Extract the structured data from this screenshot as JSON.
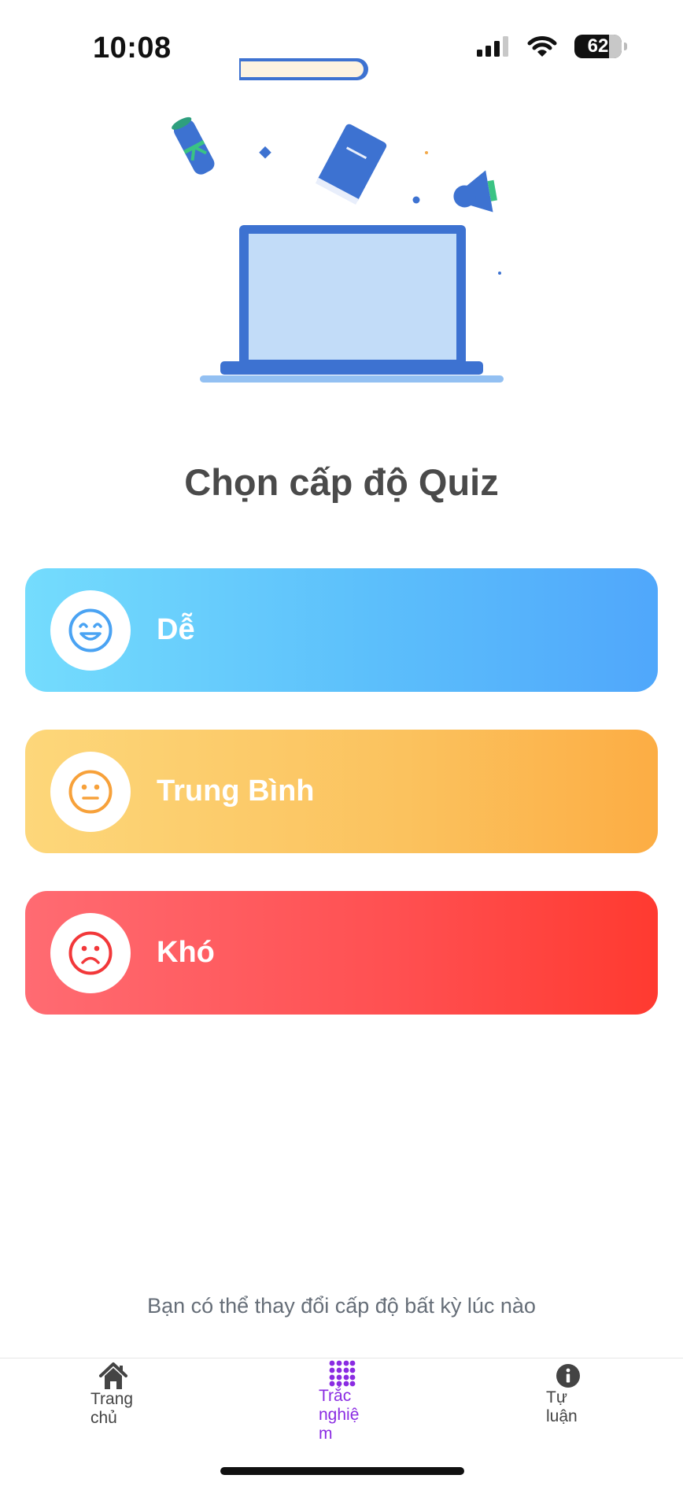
{
  "status_bar": {
    "time": "10:08",
    "battery": "62"
  },
  "title": "Chọn cấp độ Quiz",
  "levels": [
    {
      "label": "Dễ",
      "icon": "smile-face-icon",
      "color": "#5cbffb"
    },
    {
      "label": "Trung Bình",
      "icon": "neutral-face-icon",
      "color": "#fbc25e"
    },
    {
      "label": "Khó",
      "icon": "sad-face-icon",
      "color": "#ff4f50"
    }
  ],
  "hint": "Bạn có thể thay đổi cấp độ bất kỳ lúc nào",
  "tabs": [
    {
      "label_line1": "Trang",
      "label_line2": "chủ",
      "icon": "home-icon",
      "active": false
    },
    {
      "label_line1": "Trắc",
      "label_line2": "nghiệ",
      "label_line3": "m",
      "icon": "grid-icon",
      "active": true
    },
    {
      "label_line1": "Tự",
      "label_line2": "luận",
      "icon": "info-icon",
      "active": false
    }
  ],
  "colors": {
    "active_tab": "#8a2be2",
    "inactive_tab": "#444444",
    "illustration_blue": "#3d72d1"
  }
}
